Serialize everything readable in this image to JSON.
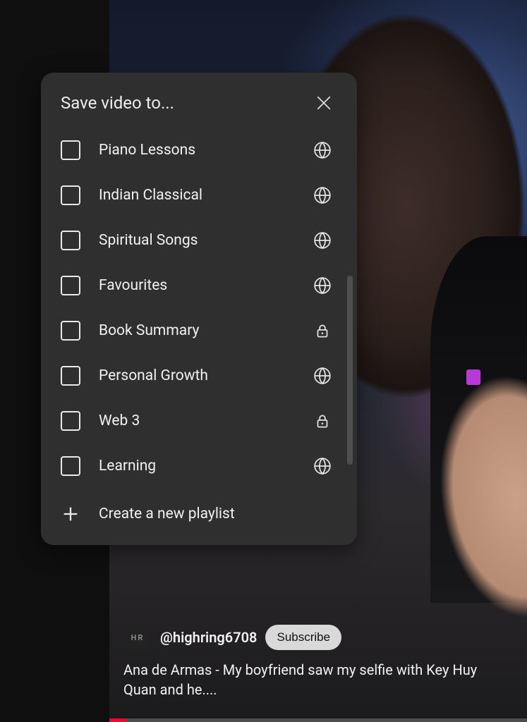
{
  "dialog": {
    "title": "Save video to...",
    "create_label": "Create a new playlist",
    "playlists": [
      {
        "label": "Piano Lessons",
        "privacy": "public"
      },
      {
        "label": "Indian Classical",
        "privacy": "public"
      },
      {
        "label": "Spiritual Songs",
        "privacy": "public"
      },
      {
        "label": "Favourites",
        "privacy": "public"
      },
      {
        "label": "Book Summary",
        "privacy": "private"
      },
      {
        "label": "Personal Growth",
        "privacy": "public"
      },
      {
        "label": "Web 3",
        "privacy": "private"
      },
      {
        "label": "Learning",
        "privacy": "public"
      }
    ]
  },
  "video": {
    "channel_avatar_initials": "HR",
    "channel_handle": "@highring6708",
    "subscribe_label": "Subscribe",
    "title": "Ana de Armas - My boyfriend saw my selfie with Key Huy Quan and he...."
  }
}
